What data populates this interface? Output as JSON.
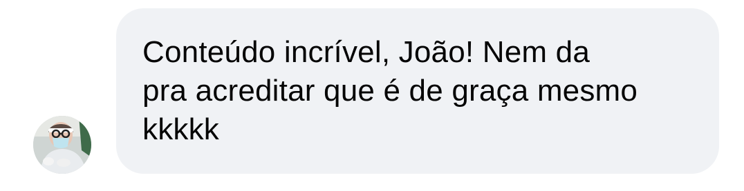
{
  "comment": {
    "text": "Conteúdo incrível, João! Nem da\npra acreditar que é de graça mesmo\nkkkkk",
    "avatar_icon": "user-avatar-photo",
    "bubble_color": "#f0f2f5",
    "text_color": "#050505"
  }
}
